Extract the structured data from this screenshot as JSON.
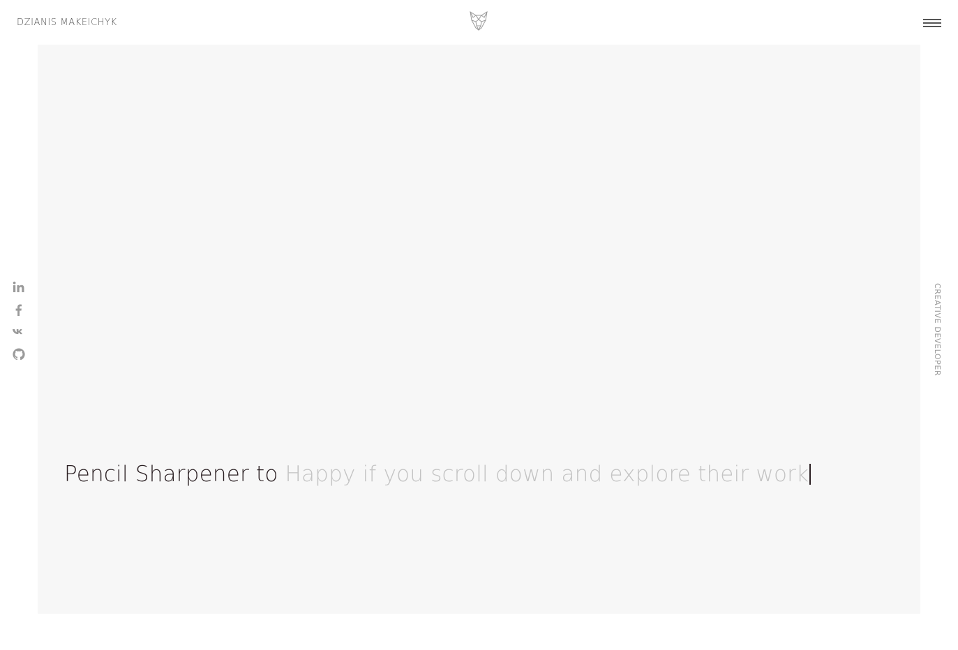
{
  "header": {
    "brand_name": "DZIANIS MAKEICHYK",
    "logo_icon": "wolf-head-logo-icon",
    "menu_icon": "hamburger-menu-icon"
  },
  "hero": {
    "headline_static": "Pencil Sharpener to",
    "headline_typed": "Happy if you scroll down and explore their work"
  },
  "social": {
    "items": [
      {
        "name": "linkedin",
        "icon": "linkedin-icon"
      },
      {
        "name": "facebook",
        "icon": "facebook-icon"
      },
      {
        "name": "vk",
        "icon": "vk-icon"
      },
      {
        "name": "github",
        "icon": "github-icon"
      }
    ]
  },
  "side": {
    "role_label": "CREATIVE DEVELOPER"
  },
  "colors": {
    "background": "#ffffff",
    "hero_background": "#f7f7f7",
    "headline_text": "#2a1f22",
    "typed_text": "#c3c3c3",
    "icon_gray": "#9a9a9a"
  }
}
